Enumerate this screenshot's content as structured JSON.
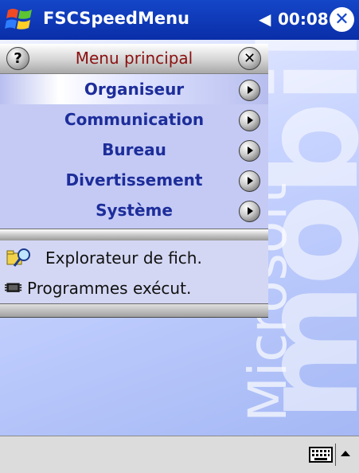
{
  "titlebar": {
    "app_title": "FSCSpeedMenu",
    "speaker_icon": "speaker-icon",
    "time": "00:08",
    "close_glyph": "✕"
  },
  "watermark": {
    "brand": "Microsoft",
    "product": "mobile"
  },
  "menu": {
    "help_glyph": "?",
    "close_glyph": "✕",
    "title": "Menu principal",
    "items": [
      {
        "label": "Organiseur",
        "selected": true
      },
      {
        "label": "Communication",
        "selected": false
      },
      {
        "label": "Bureau",
        "selected": false
      },
      {
        "label": "Divertissement",
        "selected": false
      },
      {
        "label": "Système",
        "selected": false
      }
    ],
    "shortcuts": [
      {
        "label": "Explorateur de fich.",
        "icon": "file-explorer-icon"
      },
      {
        "label": "Programmes exécut.",
        "icon": "running-programs-icon"
      }
    ]
  },
  "taskbar": {
    "keyboard_icon": "keyboard-icon",
    "sip_arrow_icon": "input-panel-arrow-icon"
  },
  "colors": {
    "titlebar": "#1446c8",
    "menu_title": "#8b1010",
    "item_text": "#1d2d9a",
    "items_bg": "#c4caf4"
  }
}
